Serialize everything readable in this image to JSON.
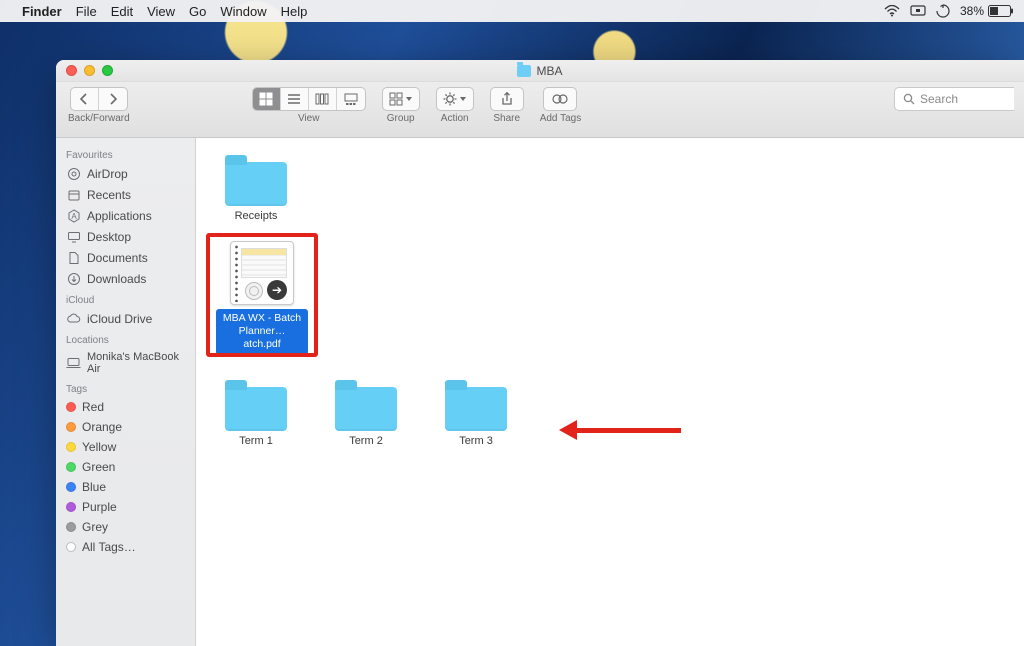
{
  "menubar": {
    "app": "Finder",
    "items": [
      "File",
      "Edit",
      "View",
      "Go",
      "Window",
      "Help"
    ],
    "battery_pct": "38%"
  },
  "window": {
    "title": "MBA",
    "toolbar": {
      "back_forward_label": "Back/Forward",
      "view_label": "View",
      "group_label": "Group",
      "action_label": "Action",
      "share_label": "Share",
      "addtags_label": "Add Tags",
      "search_placeholder": "Search"
    }
  },
  "sidebar": {
    "favourites_head": "Favourites",
    "favourites": [
      "AirDrop",
      "Recents",
      "Applications",
      "Desktop",
      "Documents",
      "Downloads"
    ],
    "icloud_head": "iCloud",
    "icloud": [
      "iCloud Drive"
    ],
    "locations_head": "Locations",
    "locations": [
      "Monika's MacBook Air"
    ],
    "tags_head": "Tags",
    "tags": [
      {
        "name": "Red",
        "color": "#ff5b53"
      },
      {
        "name": "Orange",
        "color": "#ff9a3c"
      },
      {
        "name": "Yellow",
        "color": "#ffd93c"
      },
      {
        "name": "Green",
        "color": "#4cd964"
      },
      {
        "name": "Blue",
        "color": "#3b82f6"
      },
      {
        "name": "Purple",
        "color": "#b05bdc"
      },
      {
        "name": "Grey",
        "color": "#9c9c9c"
      }
    ],
    "all_tags": "All Tags…"
  },
  "content": {
    "folder1": "Receipts",
    "selected_pdf_line1": "MBA WX - Batch",
    "selected_pdf_line2": "Planner…atch.pdf",
    "term1": "Term 1",
    "term2": "Term 2",
    "term3": "Term 3"
  }
}
